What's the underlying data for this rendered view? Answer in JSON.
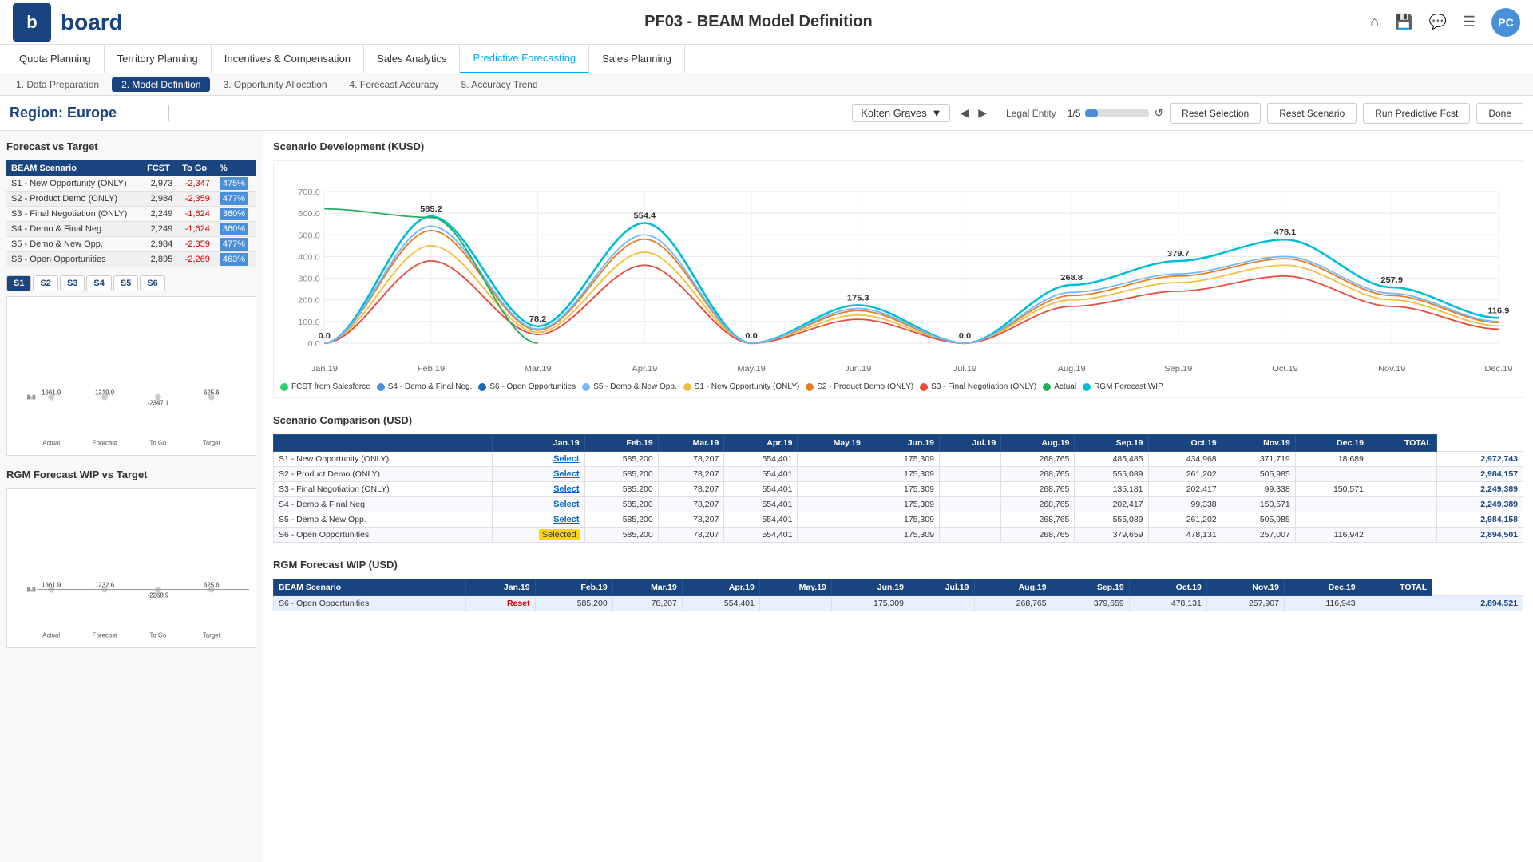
{
  "header": {
    "logo_letter": "b",
    "brand": "board",
    "title": "PF03 - BEAM Model Definition",
    "icons": [
      "home",
      "save",
      "chat",
      "menu"
    ],
    "avatar": "PC"
  },
  "nav": {
    "items": [
      {
        "label": "Quota Planning",
        "active": false
      },
      {
        "label": "Territory Planning",
        "active": false
      },
      {
        "label": "Incentives & Compensation",
        "active": false
      },
      {
        "label": "Sales Analytics",
        "active": false
      },
      {
        "label": "Predictive Forecasting",
        "active": true
      },
      {
        "label": "Sales Planning",
        "active": false
      }
    ]
  },
  "subnav": {
    "items": [
      {
        "label": "1. Data Preparation",
        "active": false
      },
      {
        "label": "2. Model Definition",
        "active": true
      },
      {
        "label": "3. Opportunity Allocation",
        "active": false
      },
      {
        "label": "4. Forecast Accuracy",
        "active": false
      },
      {
        "label": "5. Accuracy Trend",
        "active": false
      }
    ]
  },
  "toolbar": {
    "region": "Region: Europe",
    "user": "Kolten Graves",
    "legal_entity": "Legal Entity",
    "progress": "1/5",
    "progress_pct": 20,
    "reset_selection": "Reset Selection",
    "reset_scenario": "Reset Scenario",
    "run_fcst": "Run Predictive Fcst",
    "done": "Done"
  },
  "forecast_vs_target": {
    "title": "Forecast vs Target",
    "columns": [
      "BEAM Scenario",
      "FCST",
      "To Go",
      "%"
    ],
    "rows": [
      {
        "scenario": "S1 - New Opportunity (ONLY)",
        "fcst": "2,973",
        "to_go": "-2,347",
        "pct": "475%"
      },
      {
        "scenario": "S2 - Product Demo (ONLY)",
        "fcst": "2,984",
        "to_go": "-2,359",
        "pct": "477%"
      },
      {
        "scenario": "S3 - Final Negotiation (ONLY)",
        "fcst": "2,249",
        "to_go": "-1,624",
        "pct": "360%"
      },
      {
        "scenario": "S4 - Demo & Final Neg.",
        "fcst": "2,249",
        "to_go": "-1,624",
        "pct": "360%"
      },
      {
        "scenario": "S5 - Demo & New Opp.",
        "fcst": "2,984",
        "to_go": "-2,359",
        "pct": "477%"
      },
      {
        "scenario": "S6 - Open Opportunities",
        "fcst": "2,895",
        "to_go": "-2,269",
        "pct": "463%"
      }
    ]
  },
  "scenario_tabs": [
    "S1",
    "S2",
    "S3",
    "S4",
    "S5",
    "S6"
  ],
  "bar_chart_1": {
    "labels": [
      "Actual",
      "Forecast",
      "To Go",
      "Target"
    ],
    "values": [
      1661.9,
      1319.9,
      -2347.1,
      625.6
    ],
    "colors": [
      "#6ab04c",
      "#4a90d9",
      "#4a90d9",
      "#9b59b6"
    ]
  },
  "bar_chart_2": {
    "title": "RGM Forecast WIP vs Target",
    "labels": [
      "Actual",
      "Forecast",
      "To Go",
      "Target"
    ],
    "values": [
      1661.9,
      1232.6,
      -2268.9,
      625.6
    ],
    "colors": [
      "#6ab04c",
      "#4a90d9",
      "#4a90d9",
      "#9b59b6"
    ]
  },
  "scenario_dev": {
    "title": "Scenario Development (KUSD)",
    "months": [
      "Jan.19",
      "Feb.19",
      "Mar.19",
      "Apr.19",
      "May.19",
      "Jun.19",
      "Jul.19",
      "Aug.19",
      "Sep.19",
      "Oct.19",
      "Nov.19",
      "Dec.19"
    ],
    "legend": [
      {
        "label": "FCST from Salesforce",
        "color": "#2ecc71"
      },
      {
        "label": "S4 - Demo & Final Neg.",
        "color": "#4a90d9"
      },
      {
        "label": "S6 - Open Opportunities",
        "color": "#1a6bb5"
      },
      {
        "label": "S5 - Demo & New Opp.",
        "color": "#74b9ff"
      },
      {
        "label": "S1 - New Opportunity (ONLY)",
        "color": "#f0c040"
      },
      {
        "label": "S2 - Product Demo (ONLY)",
        "color": "#e67e22"
      },
      {
        "label": "S3 - Final Negotiation (ONLY)",
        "color": "#e74c3c"
      },
      {
        "label": "Actual",
        "color": "#27ae60"
      },
      {
        "label": "RGM Forecast WIP",
        "color": "#00bcd4"
      }
    ],
    "data_points": {
      "main_curve": [
        0.0,
        585.2,
        78.2,
        554.4,
        0.0,
        175.3,
        0.0,
        268.8,
        379.7,
        478.1,
        257.9,
        116.9
      ]
    }
  },
  "scenario_comparison": {
    "title": "Scenario Comparison (USD)",
    "columns": [
      "",
      "Jan.19",
      "Feb.19",
      "Mar.19",
      "Apr.19",
      "May.19",
      "Jun.19",
      "Jul.19",
      "Aug.19",
      "Sep.19",
      "Oct.19",
      "Nov.19",
      "Dec.19",
      "TOTAL"
    ],
    "rows": [
      {
        "scenario": "S1 - New Opportunity (ONLY)",
        "action": "Select",
        "values": [
          "585,200",
          "78,207",
          "554,401",
          "",
          "175,309",
          "",
          "268,765",
          "485,485",
          "434,968",
          "371,719",
          "18,689",
          ""
        ],
        "total": "2,972,743"
      },
      {
        "scenario": "S2 - Product Demo (ONLY)",
        "action": "Select",
        "values": [
          "585,200",
          "78,207",
          "554,401",
          "",
          "175,309",
          "",
          "268,765",
          "555,089",
          "261,202",
          "505,985",
          "",
          ""
        ],
        "total": "2,984,157"
      },
      {
        "scenario": "S3 - Final Negotiation (ONLY)",
        "action": "Select",
        "values": [
          "585,200",
          "78,207",
          "554,401",
          "",
          "175,309",
          "",
          "268,765",
          "135,181",
          "202,417",
          "99,338",
          "150,571",
          ""
        ],
        "total": "2,249,389"
      },
      {
        "scenario": "S4 - Demo & Final Neg.",
        "action": "Select",
        "values": [
          "585,200",
          "78,207",
          "554,401",
          "",
          "175,309",
          "",
          "268,765",
          "202,417",
          "99,338",
          "150,571",
          "",
          ""
        ],
        "total": "2,249,389"
      },
      {
        "scenario": "S5 - Demo & New Opp.",
        "action": "Select",
        "values": [
          "585,200",
          "78,207",
          "554,401",
          "",
          "175,309",
          "",
          "268,765",
          "555,089",
          "261,202",
          "505,985",
          "",
          ""
        ],
        "total": "2,984,158"
      },
      {
        "scenario": "S6 - Open Opportunities",
        "action": "Selected",
        "values": [
          "585,200",
          "78,207",
          "554,401",
          "",
          "175,309",
          "",
          "268,765",
          "379,659",
          "478,131",
          "257,007",
          "116,942",
          ""
        ],
        "total": "2,894,501"
      }
    ]
  },
  "rgm_forecast": {
    "title": "RGM Forecast WIP (USD)",
    "columns": [
      "BEAM Scenario",
      "Jan.19",
      "Feb.19",
      "Mar.19",
      "Apr.19",
      "May.19",
      "Jun.19",
      "Jul.19",
      "Aug.19",
      "Sep.19",
      "Oct.19",
      "Nov.19",
      "Dec.19",
      "TOTAL"
    ],
    "rows": [
      {
        "scenario": "S6 - Open Opportunities",
        "action": "Reset",
        "values": [
          "585,200",
          "78,207",
          "554,401",
          "",
          "175,309",
          "",
          "268,765",
          "379,659",
          "478,131",
          "257,907",
          "116,943",
          ""
        ],
        "total": "2,894,521"
      }
    ]
  }
}
